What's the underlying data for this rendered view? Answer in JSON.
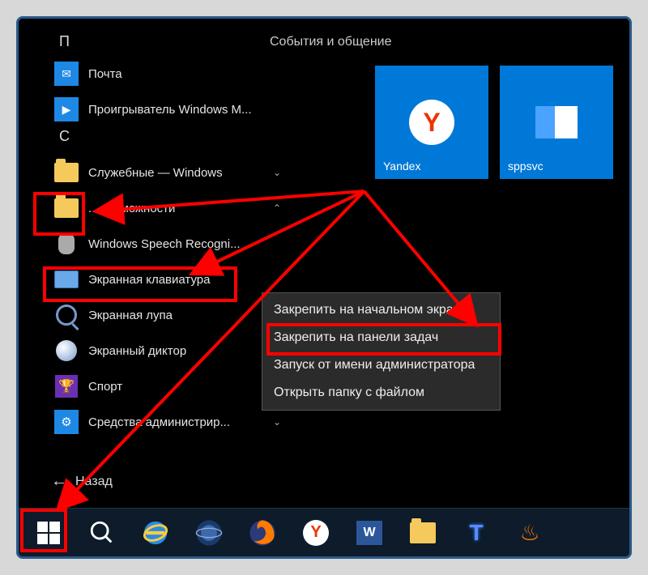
{
  "section_title": "События и общение",
  "letters": {
    "p": "П",
    "c": "С"
  },
  "apps": {
    "pochta": "Почта",
    "wmp": "Проигрыватель Windows M...",
    "system_tools": "Служебные — Windows",
    "spec_abilities": "... возможности",
    "speech": "Windows Speech Recogni...",
    "osk": "Экранная клавиатура",
    "magnifier": "Экранная лупа",
    "narrator": "Экранный диктор",
    "sport": "Спорт",
    "admin_tools": "Средства администрир..."
  },
  "tiles": {
    "yandex": "Yandex",
    "sppsvc": "sppsvc"
  },
  "context_menu": {
    "pin_start": "Закрепить на начальном экране",
    "pin_taskbar": "Закрепить на панели задач",
    "run_admin": "Запуск от имени администратора",
    "open_folder": "Открыть папку с файлом"
  },
  "back_label": "Назад",
  "colors": {
    "accent": "#0078d7",
    "highlight": "#ff0000"
  }
}
